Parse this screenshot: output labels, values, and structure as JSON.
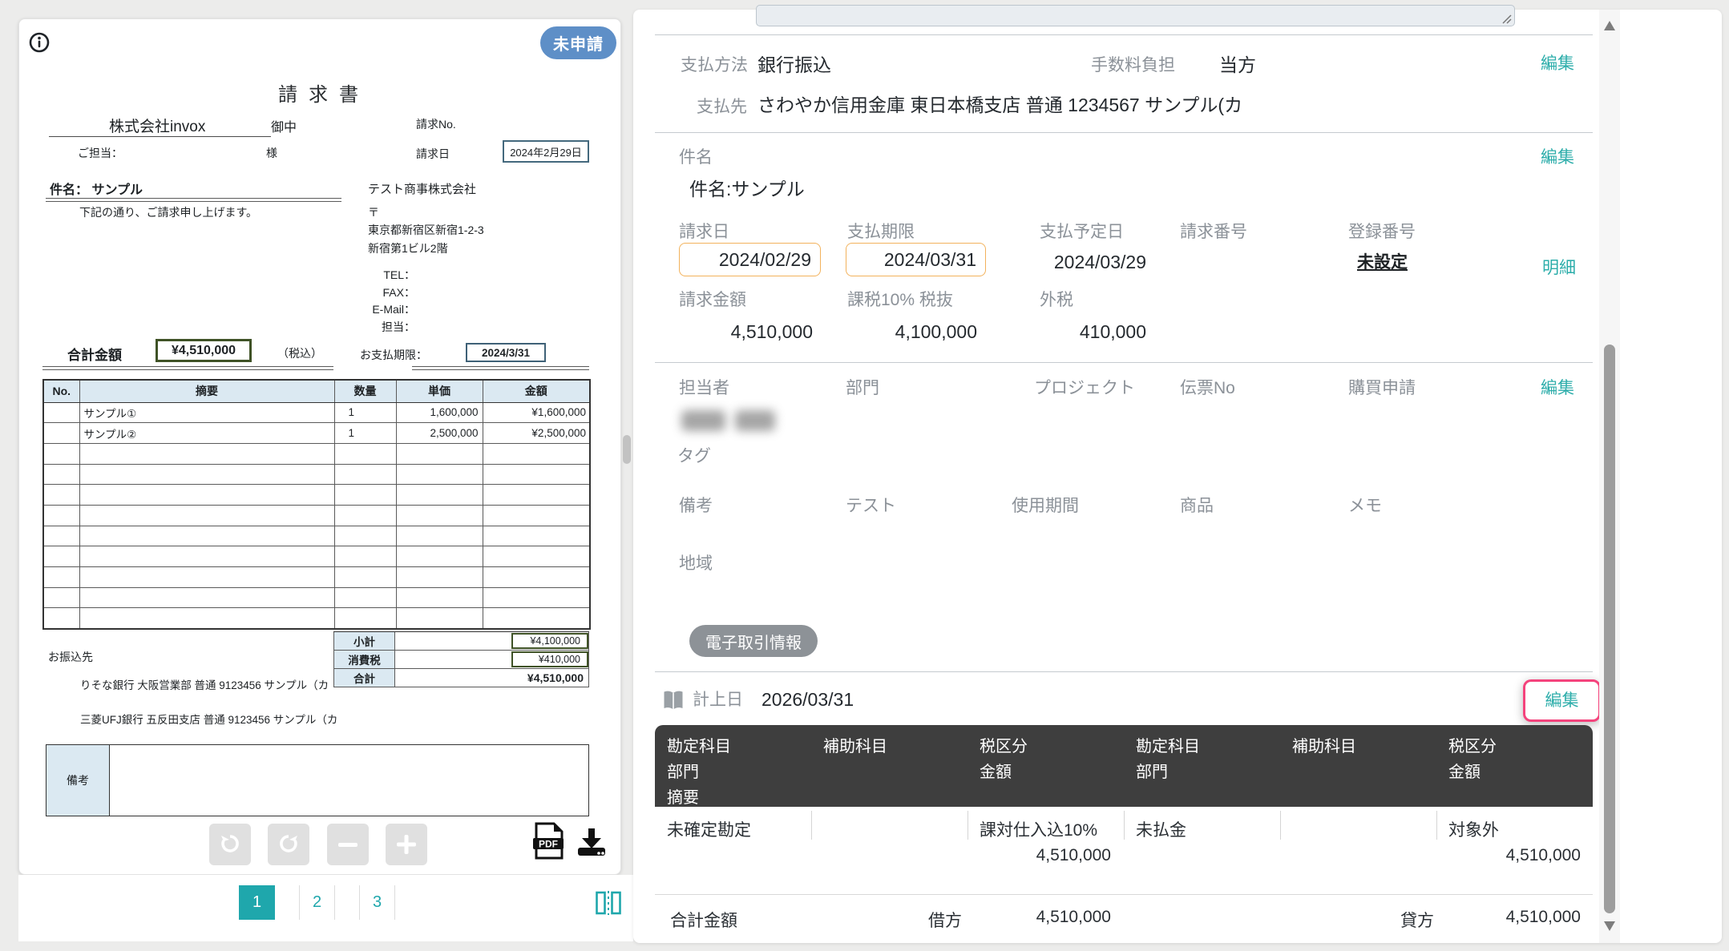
{
  "colors": {
    "teal": "#1fa7ac",
    "link_teal": "#2cadaa",
    "badge_blue": "#5e8fc7",
    "pink_highlight": "#f4437c",
    "orange_border": "#f2b25c",
    "olive_border": "#3f5226",
    "slate_border": "#44697d",
    "table_header_blue": "#dbe9f2",
    "dark_header": "#3e3e3e",
    "label_gray": "#8b9198"
  },
  "viewer": {
    "status": "未申請",
    "doc": {
      "title": "請求書",
      "recipient": "株式会社invox",
      "honorific": "御中",
      "contact_label": "ご担当：",
      "contact_suffix": "様",
      "invoice_no_label": "請求No.",
      "invoice_date_label": "請求日",
      "invoice_date": "2024年2月29日",
      "subject_line": "件名： サンプル",
      "greeting": "下記の通り、ご請求申し上げます。",
      "issuer": "テスト商事株式会社",
      "postal": "〒",
      "address1": "東京都新宿区新宿1-2-3",
      "address2": "新宿第1ビル2階",
      "tel_label": "TEL：",
      "fax_label": "FAX：",
      "email_label": "E-Mail：",
      "staff_label": "担当：",
      "total_label": "合計金額",
      "total": "¥4,510,000",
      "tax_included": "（税込）",
      "due_label": "お支払期限：",
      "due": "2024/3/31",
      "table": {
        "headers": [
          "No.",
          "摘要",
          "数量",
          "単価",
          "金額"
        ],
        "rows": [
          {
            "no": "",
            "desc": "サンプル①",
            "qty": "1",
            "unit": "1,600,000",
            "amount": "¥1,600,000"
          },
          {
            "no": "",
            "desc": "サンプル②",
            "qty": "1",
            "unit": "2,500,000",
            "amount": "¥2,500,000"
          }
        ],
        "empty_row_count": 9,
        "subtotal_label": "小計",
        "subtotal": "¥4,100,000",
        "tax_label": "消費税",
        "tax": "¥410,000",
        "total_label": "合計",
        "total": "¥4,510,000"
      },
      "bank_label": "お振込先",
      "bank1": "りそな銀行 大阪営業部 普通 9123456 サンプル（カ",
      "bank2": "三菱UFJ銀行 五反田支店 普通 9123456 サンプル（カ",
      "notes_label": "備考"
    },
    "pagination": {
      "pages": [
        "1",
        "2",
        "3"
      ],
      "active": "1"
    }
  },
  "detail": {
    "payment": {
      "method_label": "支払方法",
      "method": "銀行振込",
      "fee_label": "手数料負担",
      "fee": "当方",
      "edit": "編集",
      "payee_label": "支払先",
      "payee": "さわやか信用金庫 東日本橋支店 普通 1234567 サンプル(カ"
    },
    "subject": {
      "label": "件名",
      "value": "件名:サンプル",
      "edit": "編集"
    },
    "dates": {
      "invoice_date_label": "請求日",
      "invoice_date": "2024/02/29",
      "due_label": "支払期限",
      "due": "2024/03/31",
      "plan_label": "支払予定日",
      "plan": "2024/03/29",
      "invoice_no_label": "請求番号",
      "reg_label": "登録番号",
      "reg": "未設定",
      "detail_link": "明細"
    },
    "amounts": {
      "billed_label": "請求金額",
      "billed": "4,510,000",
      "taxable_label": "課税10% 税抜",
      "taxable": "4,100,000",
      "tax_label": "外税",
      "tax": "410,000"
    },
    "assign": {
      "person_label": "担当者",
      "dept_label": "部門",
      "project_label": "プロジェクト",
      "slip_label": "伝票No",
      "purchase_label": "購買申請",
      "edit": "編集",
      "tag_label": "タグ",
      "note_label": "備考",
      "custom_label": "テスト",
      "period_label": "使用期間",
      "item_label": "商品",
      "memo_label": "メモ",
      "region_label": "地域"
    },
    "edoc_button": "電子取引情報",
    "journal": {
      "date_label": "計上日",
      "date": "2026/03/31",
      "edit": "編集",
      "h_account": "勘定科目",
      "h_sub": "補助科目",
      "h_tax": "税区分",
      "h_dept": "部門",
      "h_amount": "金額",
      "h_summary": "摘要",
      "debit_account": "未確定勘定",
      "debit_tax": "課対仕入込10%",
      "debit_amount": "4,510,000",
      "credit_account": "未払金",
      "credit_tax": "対象外",
      "credit_amount": "4,510,000",
      "footer_label": "合計金額",
      "debit_label": "借方",
      "debit_total": "4,510,000",
      "credit_label": "貸方",
      "credit_total": "4,510,000"
    }
  }
}
